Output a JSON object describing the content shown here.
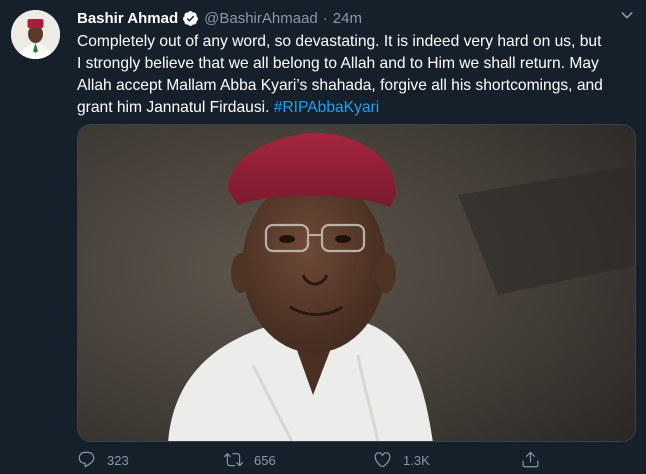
{
  "tweet": {
    "display_name": "Bashir Ahmad",
    "handle": "@BashirAhmaad",
    "separator": "·",
    "time": "24m",
    "text_main": "Completely out of any word, so devastating. It is indeed very hard on us, but\nI strongly believe that we all belong to Allah and to Him we shall return. May\nAllah accept Mallam Abba Kyari’s shahada, forgive all his shortcomings, and\ngrant him Jannatul Firdausi. ",
    "hashtag": "#RIPAbbaKyari"
  },
  "actions": {
    "reply_count": "323",
    "retweet_count": "656",
    "like_count": "1.3K"
  },
  "colors": {
    "background": "#15202b",
    "accent": "#1da1f2",
    "muted": "#8899a6",
    "verified": "#1da1f2"
  },
  "icons": [
    "verified-badge-icon",
    "chevron-down-icon",
    "reply-icon",
    "retweet-icon",
    "like-icon",
    "share-icon"
  ]
}
